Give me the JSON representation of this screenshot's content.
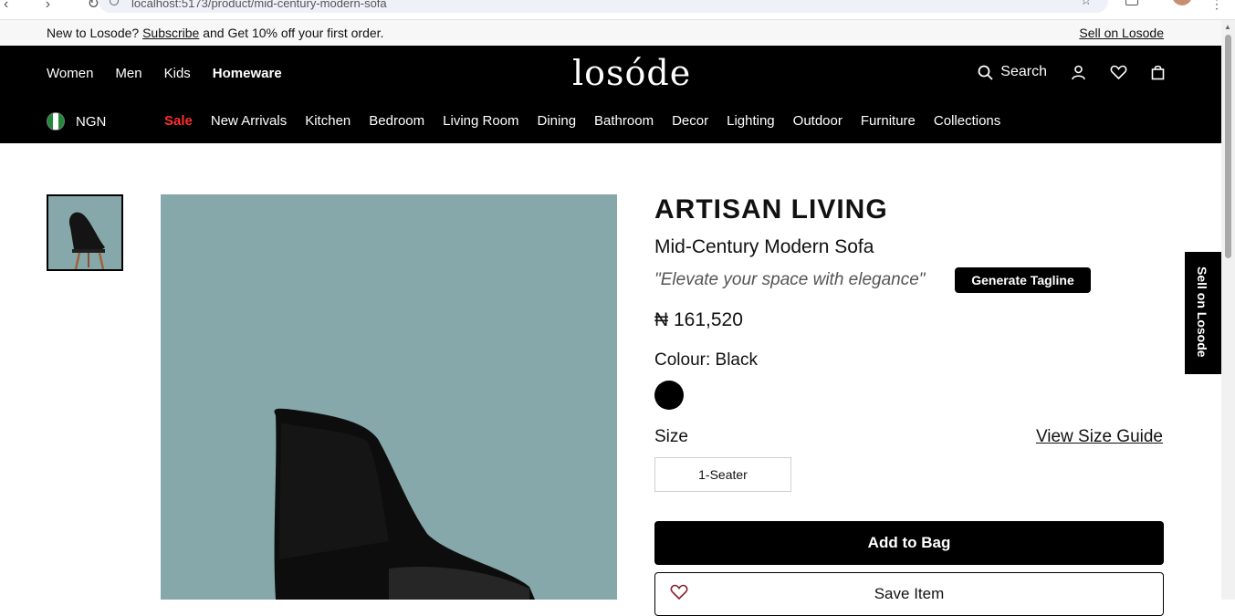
{
  "browser": {
    "url": "localhost:5173/product/mid-century-modern-sofa"
  },
  "promo": {
    "prefix": "New to Losode?",
    "subscribe_link": "Subscribe",
    "suffix": "and Get 10% off your first order.",
    "sell_link": "Sell on Losode"
  },
  "header": {
    "logo": "losóde",
    "main_nav": [
      "Women",
      "Men",
      "Kids",
      "Homeware"
    ],
    "active_nav": "Homeware",
    "search_label": "Search",
    "currency": "NGN",
    "sub_nav": [
      "Sale",
      "New Arrivals",
      "Kitchen",
      "Bedroom",
      "Living Room",
      "Dining",
      "Bathroom",
      "Decor",
      "Lighting",
      "Outdoor",
      "Furniture",
      "Collections"
    ]
  },
  "product": {
    "brand": "ARTISAN LIVING",
    "name": "Mid-Century Modern Sofa",
    "tagline": "\"Elevate your space with elegance\"",
    "generate_tagline_label": "Generate Tagline",
    "price": "₦ 161,520",
    "colour_label": "Colour: Black",
    "colour_swatch": "#000000",
    "size_label": "Size",
    "size_guide_link": "View Size Guide",
    "size_option": "1-Seater",
    "add_to_bag_label": "Add to Bag",
    "save_item_label": "Save Item",
    "image_bg": "#86a8aa"
  },
  "side_tab": {
    "label": "Sell on Losode"
  }
}
